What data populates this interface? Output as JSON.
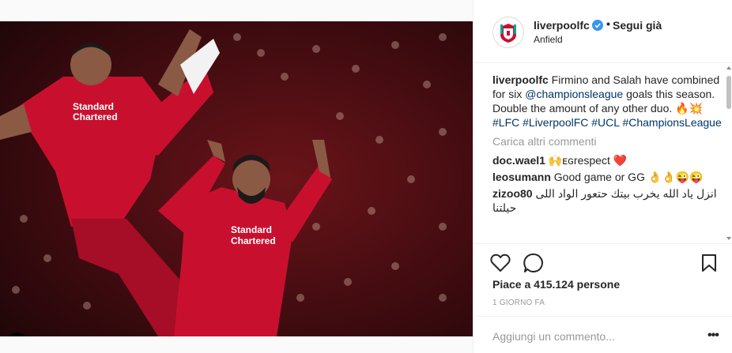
{
  "post": {
    "username": "liverpoolfc",
    "verified": true,
    "follow_dot": "•",
    "follow_label": "Segui già",
    "location": "Anfield",
    "caption_user": "liverpoolfc",
    "caption_part1": " Firmino and Salah have combined for six ",
    "caption_mention": "@championsleague",
    "caption_part2": " goals this season. Double the amount of any other duo. 🔥💥 ",
    "caption_tags": "#LFC #LiverpoolFC #UCL #ChampionsLeague",
    "load_more": "Carica altri commenti",
    "comments": [
      {
        "user": "doc.wael1",
        "text": "🙌ᴇɢrespect ❤️"
      },
      {
        "user": "leosumann",
        "text": "Good game or GG 👌👌😜😜"
      },
      {
        "user": "zizoo80",
        "text": "انزل ياد الله يخرب بيتك حتعور الواد اللى حيلتنا"
      }
    ],
    "likes": "Piace a 415.124 persone",
    "date": "1 GIORNO FA",
    "comment_placeholder": "Aggiungi un commento...",
    "more_label": "•••"
  },
  "colors": {
    "verified_blue": "#3897f0",
    "link": "#003569",
    "liverpool_red": "#c8102e"
  },
  "icons": [
    "heart-icon",
    "comment-icon",
    "bookmark-icon",
    "user-tag-icon",
    "verified-badge-icon",
    "liverpool-crest-icon"
  ]
}
